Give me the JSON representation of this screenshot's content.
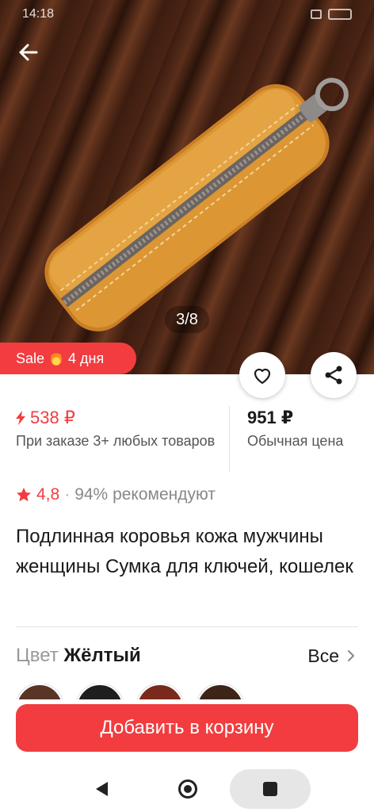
{
  "status_bar": {
    "time": "14:18"
  },
  "gallery": {
    "counter": "3/8"
  },
  "sale_badge": {
    "label": "Sale",
    "days": "4 дня"
  },
  "pricing": {
    "sale_price": "538 ₽",
    "sale_note": "При заказе 3+ любых товаров",
    "regular_price": "951 ₽",
    "regular_note": "Обычная цена"
  },
  "rating": {
    "value": "4,8",
    "separator": "·",
    "recommend": "94% рекомендуют"
  },
  "product": {
    "title": "Подлинная коровья кожа мужчины женщины Сумка для ключей, кошелек"
  },
  "color": {
    "label": "Цвет",
    "selected": "Жёлтый",
    "all_link": "Все"
  },
  "cart": {
    "button_label": "Добавить в корзину"
  },
  "colors": {
    "accent": "#f23c3f",
    "product": "#d98c2b"
  },
  "icons": [
    "back-arrow-icon",
    "heart-icon",
    "share-icon",
    "flame-icon",
    "lightning-icon",
    "star-icon",
    "chevron-right-icon"
  ]
}
